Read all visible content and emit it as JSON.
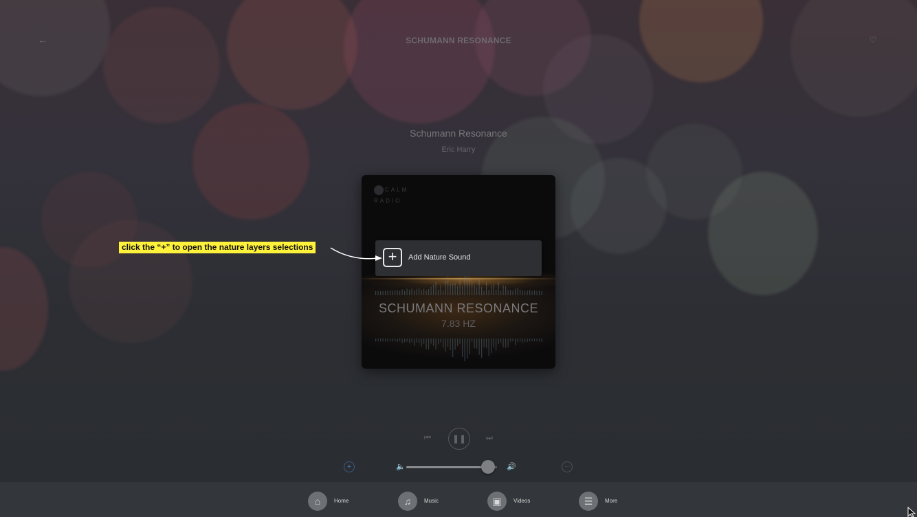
{
  "header": {
    "title": "SCHUMANN RESONANCE",
    "back_icon": "back-arrow-icon",
    "favorite_icon": "heart-icon"
  },
  "track": {
    "title": "Schumann Resonance",
    "artist": "Eric Harry"
  },
  "artwork": {
    "brand": "CALM RADIO",
    "title": "SCHUMANN RESONANCE",
    "subtitle": "7.83 HZ"
  },
  "nature_popup": {
    "label": "Add Nature Sound",
    "icon": "plus-icon"
  },
  "annotation": {
    "text": "click the “+” to open the nature layers selections",
    "color": "#fff23a"
  },
  "controls": {
    "prev_icon": "skip-previous-icon",
    "pause_icon": "pause-icon",
    "next_icon": "skip-next-icon",
    "volume_level": 0.9,
    "nature_icon": "plus-circle-icon",
    "more_icon": "more-icon"
  },
  "nav": {
    "items": [
      {
        "label": "Home",
        "icon": "home-icon"
      },
      {
        "label": "Music",
        "icon": "music-note-icon"
      },
      {
        "label": "Videos",
        "icon": "film-icon"
      },
      {
        "label": "More",
        "icon": "menu-icon"
      }
    ]
  },
  "colors": {
    "accent": "#4b74b0",
    "nav_bg": "#33363a"
  }
}
